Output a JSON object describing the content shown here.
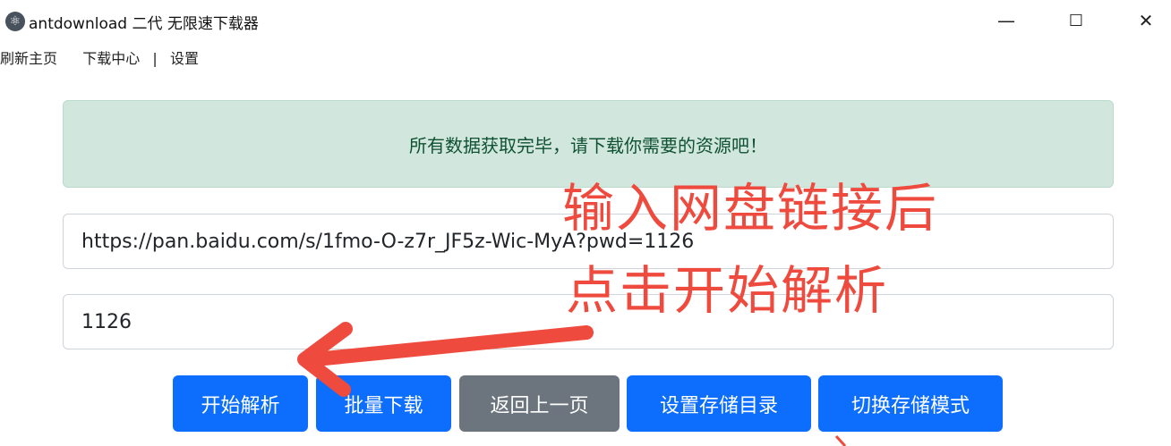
{
  "window": {
    "title": "antdownload 二代 无限速下载器",
    "icon": "electron-atom-icon",
    "controls": {
      "minimize": "—",
      "maximize": "☐",
      "close": "✕"
    }
  },
  "menu": {
    "refresh": "刷新主页",
    "download_center": "下载中心",
    "separator": "|",
    "settings": "设置"
  },
  "alert": {
    "message": "所有数据获取完毕，请下载你需要的资源吧！"
  },
  "inputs": {
    "share_url": "https://pan.baidu.com/s/1fmo-O-z7r_JF5z-Wic-MyA?pwd=1126",
    "password": "1126"
  },
  "buttons": {
    "start_parse": "开始解析",
    "batch_download": "批量下载",
    "go_back": "返回上一页",
    "set_storage_dir": "设置存储目录",
    "switch_storage_mode": "切换存储模式"
  },
  "annotation": {
    "line1": "输入网盘链接后",
    "line2": "点击开始解析",
    "color": "#ef4a3e"
  },
  "colors": {
    "alert_bg": "#d1e7dd",
    "alert_text": "#0f5132",
    "primary": "#0d6efd",
    "secondary": "#6c757d"
  }
}
